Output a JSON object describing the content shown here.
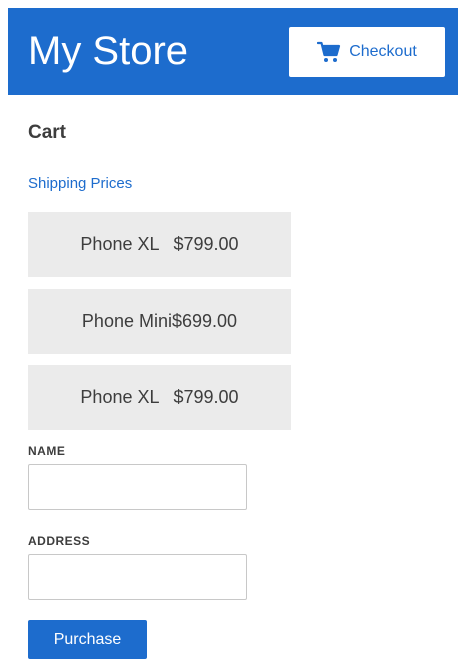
{
  "header": {
    "brand": "My Store",
    "checkout_label": "Checkout",
    "checkout_icon": "shopping-cart-icon",
    "background_color": "#1d6ccd",
    "accent_color": "#1d6ccd"
  },
  "cart": {
    "title": "Cart",
    "shipping_link": "Shipping Prices",
    "items": [
      {
        "name": "Phone XL",
        "price": "$799.00"
      },
      {
        "name": "Phone Mini",
        "price": "$699.00"
      },
      {
        "name": "Phone XL",
        "price": "$799.00"
      }
    ],
    "item_background": "#ebebeb"
  },
  "form": {
    "name_label": "NAME",
    "name_value": "",
    "address_label": "ADDRESS",
    "address_value": "",
    "purchase_label": "Purchase"
  }
}
